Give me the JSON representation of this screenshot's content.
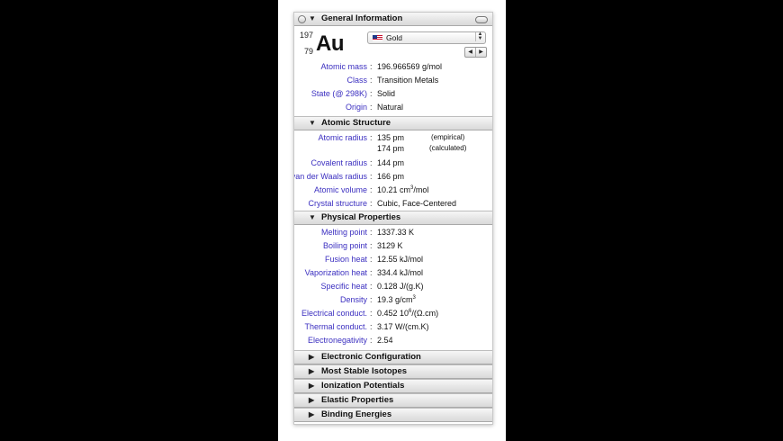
{
  "general": {
    "title": "General Information",
    "mass_number": "197",
    "atomic_number": "79",
    "symbol": "Au",
    "element_name": "Gold",
    "rows": [
      {
        "label": "Atomic mass",
        "value": "196.966569 g/mol"
      },
      {
        "label": "Class",
        "value": "Transition Metals"
      },
      {
        "label": "State (@ 298K)",
        "value": "Solid"
      },
      {
        "label": "Origin",
        "value": "Natural"
      }
    ]
  },
  "atomic_structure": {
    "title": "Atomic Structure",
    "radius_label": "Atomic radius",
    "radius_empirical": "135 pm",
    "radius_empirical_note": "(empirical)",
    "radius_calculated": "174 pm",
    "radius_calculated_note": "(calculated)",
    "rows": [
      {
        "label": "Covalent radius",
        "value": "144 pm"
      },
      {
        "label": "van der Waals radius",
        "value": "166 pm"
      }
    ],
    "volume_label": "Atomic volume",
    "volume_value": "10.21 cm",
    "volume_exp": "3",
    "volume_unit": "/mol",
    "crystal_label": "Crystal structure",
    "crystal_value": "Cubic, Face-Centered"
  },
  "physical": {
    "title": "Physical Properties",
    "rows": [
      {
        "label": "Melting point",
        "value": "1337.33 K"
      },
      {
        "label": "Boiling point",
        "value": "3129 K"
      },
      {
        "label": "Fusion heat",
        "value": "12.55 kJ/mol"
      },
      {
        "label": "Vaporization heat",
        "value": "334.4 kJ/mol"
      },
      {
        "label": "Specific heat",
        "value": "0.128 J/(g.K)"
      }
    ],
    "density_label": "Density",
    "density_value": "19.3 g/cm",
    "density_exp": "3",
    "elec_label": "Electrical conduct.",
    "elec_value": "0.452 10",
    "elec_exp": "6",
    "elec_unit": "/(Ω.cm)",
    "thermal_label": "Thermal conduct.",
    "thermal_value": "3.17 W/(cm.K)",
    "electroneg_label": "Electronegativity",
    "electroneg_value": "2.54"
  },
  "collapsed_sections": [
    "Electronic Configuration",
    "Most Stable Isotopes",
    "Ionization Potentials",
    "Elastic Properties",
    "Binding Energies"
  ],
  "glyphs": {
    "expanded": "▼",
    "collapsed": "▶",
    "colon": ":",
    "step_left": "◀",
    "step_right": "▶",
    "select_up": "▲",
    "select_down": "▼"
  }
}
